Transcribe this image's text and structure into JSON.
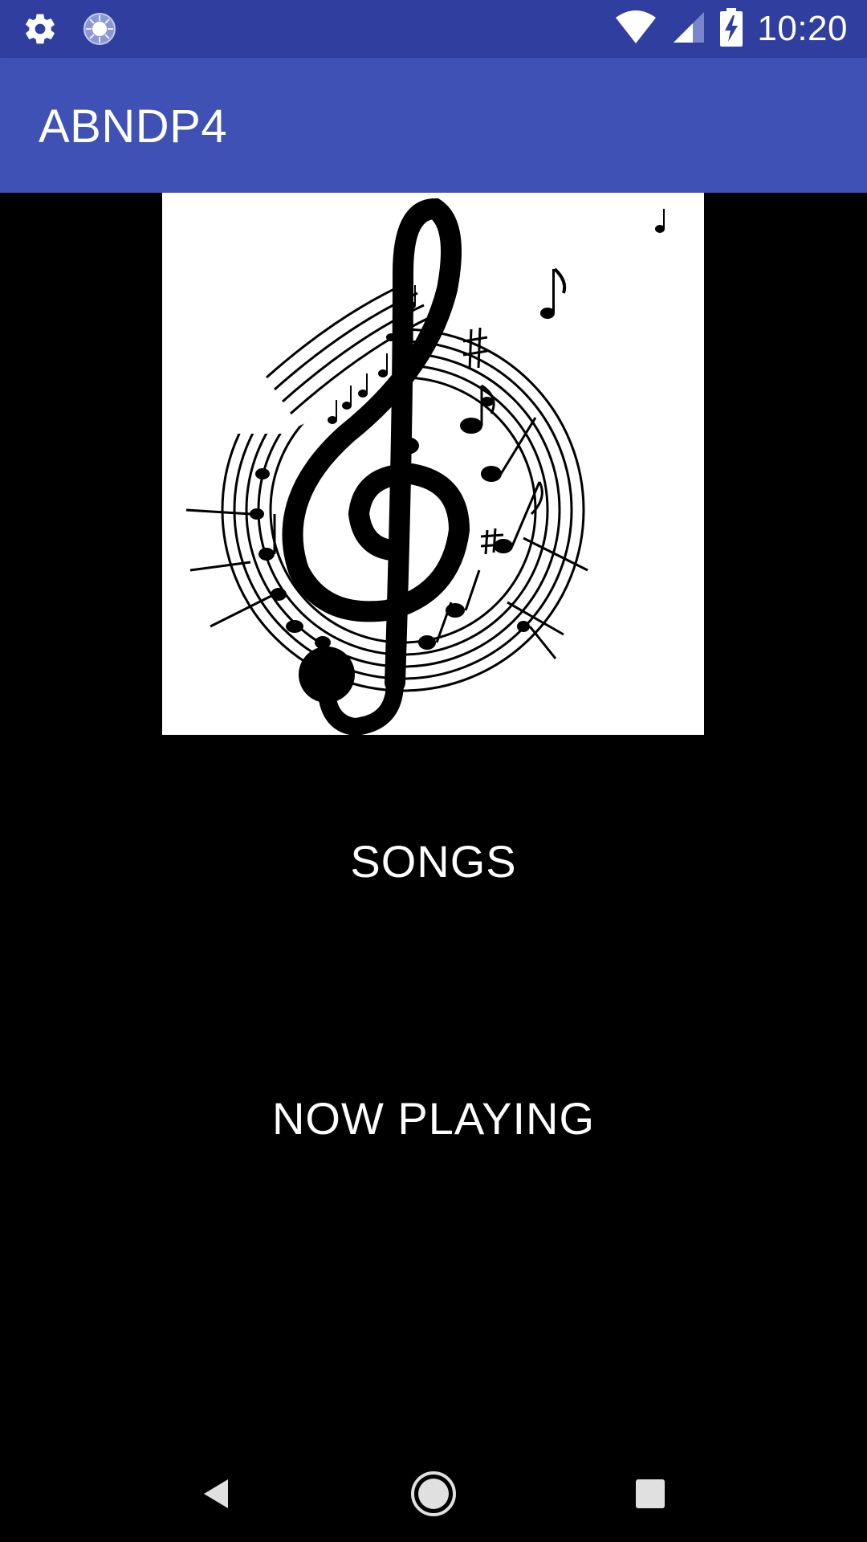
{
  "status_bar": {
    "time": "10:20",
    "icons": [
      "settings-icon",
      "sync-icon",
      "wifi-icon",
      "cellular-signal-icon",
      "battery-charging-icon"
    ]
  },
  "app_bar": {
    "title": "ABNDP4"
  },
  "main": {
    "album_art_icon": "treble-clef-music-notes-icon",
    "songs_label": "SONGS",
    "now_playing_label": "NOW PLAYING"
  },
  "nav_bar": {
    "icons": [
      "back-icon",
      "home-icon",
      "recents-icon"
    ]
  },
  "colors": {
    "status_bar": "#303F9F",
    "app_bar": "#3F51B5",
    "background": "#000000",
    "text": "#FFFFFF"
  }
}
